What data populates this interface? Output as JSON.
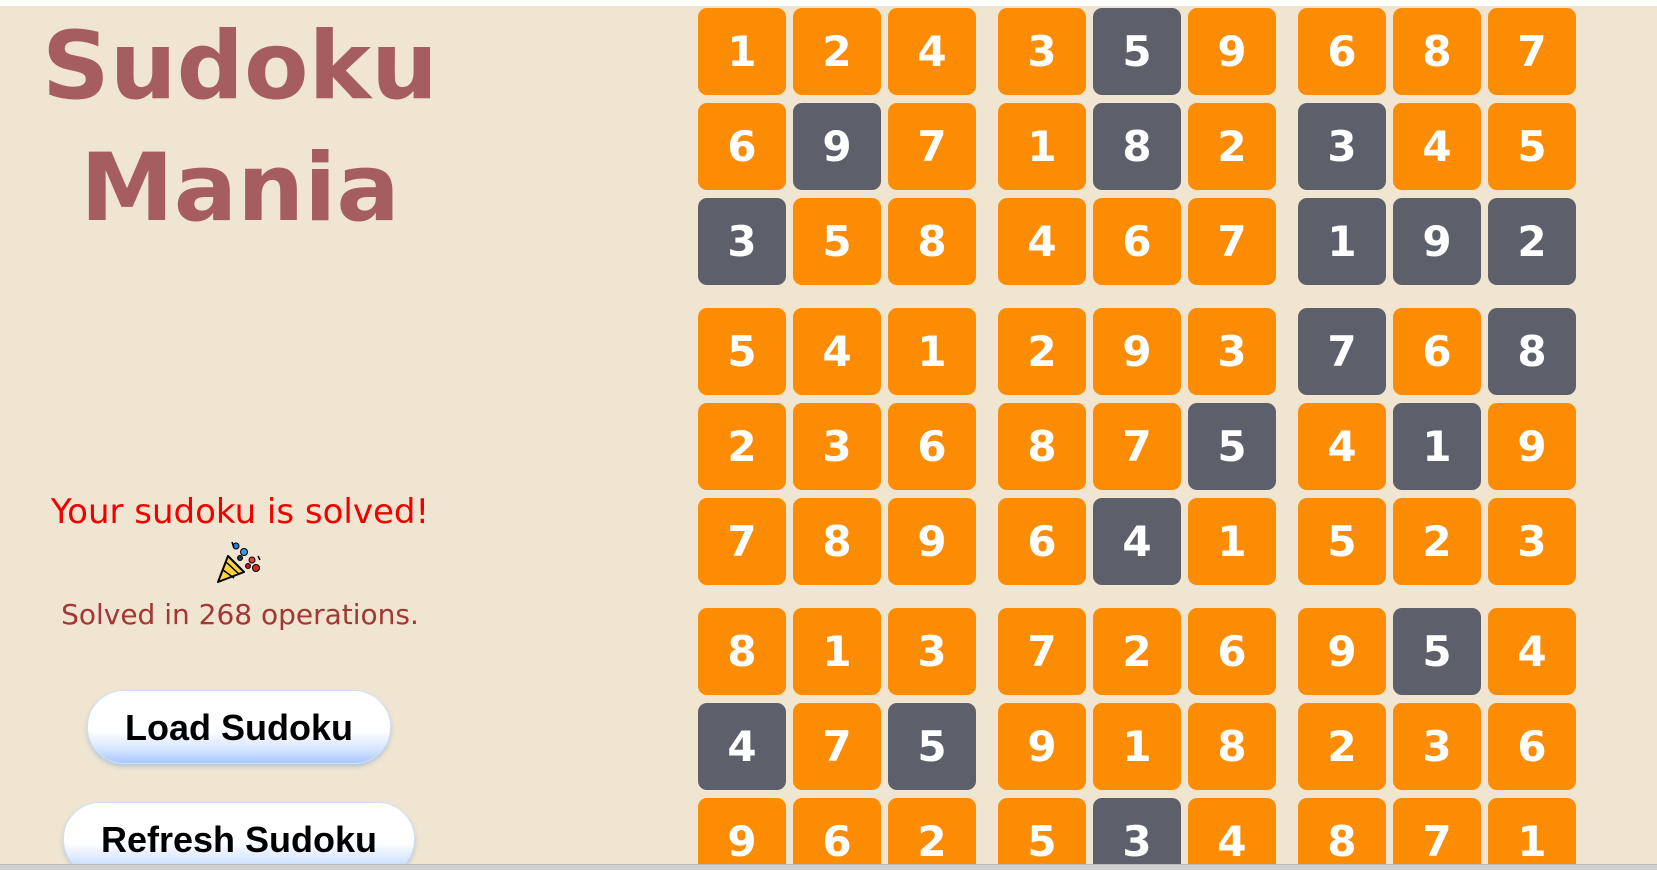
{
  "title": {
    "line1": "Sudoku",
    "line2": "Mania"
  },
  "status": {
    "message": "Your sudoku is solved!",
    "operations": "Solved in 268 operations.",
    "celebration_icon": "party-popper-icon"
  },
  "buttons": {
    "load_label": "Load Sudoku",
    "refresh_label": "Refresh Sudoku"
  },
  "colors": {
    "background": "#efe5d0",
    "title": "#a55d60",
    "status": "#f20000",
    "operations": "#a33636",
    "solved_cell": "#fb8c04",
    "given_cell": "#5d5f6b"
  },
  "board": {
    "values": [
      [
        1,
        2,
        4,
        3,
        5,
        9,
        6,
        8,
        7
      ],
      [
        6,
        9,
        7,
        1,
        8,
        2,
        3,
        4,
        5
      ],
      [
        3,
        5,
        8,
        4,
        6,
        7,
        1,
        9,
        2
      ],
      [
        5,
        4,
        1,
        2,
        9,
        3,
        7,
        6,
        8
      ],
      [
        2,
        3,
        6,
        8,
        7,
        5,
        4,
        1,
        9
      ],
      [
        7,
        8,
        9,
        6,
        4,
        1,
        5,
        2,
        3
      ],
      [
        8,
        1,
        3,
        7,
        2,
        6,
        9,
        5,
        4
      ],
      [
        4,
        7,
        5,
        9,
        1,
        8,
        2,
        3,
        6
      ],
      [
        9,
        6,
        2,
        5,
        3,
        4,
        8,
        7,
        1
      ]
    ],
    "givens": [
      [
        0,
        0,
        0,
        0,
        1,
        0,
        0,
        0,
        0
      ],
      [
        0,
        1,
        0,
        0,
        1,
        0,
        1,
        0,
        0
      ],
      [
        1,
        0,
        0,
        0,
        0,
        0,
        1,
        1,
        1
      ],
      [
        0,
        0,
        0,
        0,
        0,
        0,
        1,
        0,
        1
      ],
      [
        0,
        0,
        0,
        0,
        0,
        1,
        0,
        1,
        0
      ],
      [
        0,
        0,
        0,
        0,
        1,
        0,
        0,
        0,
        0
      ],
      [
        0,
        0,
        0,
        0,
        0,
        0,
        0,
        1,
        0
      ],
      [
        1,
        0,
        1,
        0,
        0,
        0,
        0,
        0,
        0
      ],
      [
        0,
        0,
        0,
        0,
        1,
        0,
        0,
        0,
        0
      ]
    ]
  }
}
